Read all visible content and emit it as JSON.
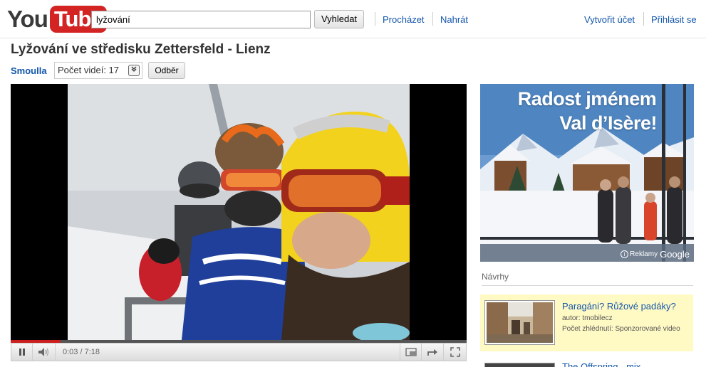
{
  "header": {
    "logo_you": "You",
    "logo_tube": "Tube",
    "search_value": "lyžování",
    "search_button": "Vyhledat",
    "nav_browse": "Procházet",
    "nav_upload": "Nahrát",
    "create_account": "Vytvořit účet",
    "sign_in": "Přihlásit se"
  },
  "video": {
    "title": "Lyžování ve středisku Zettersfeld - Lienz",
    "channel": "Smoulla",
    "video_count": "Počet videí: 17",
    "subscribe": "Odběr",
    "time_current": "0:03",
    "time_total": "7:18",
    "played_fraction": 0.11
  },
  "ad": {
    "line1": "Radost jménem",
    "line2": "Val d’Isère!",
    "footer_label": "Reklamy",
    "footer_brand": "Google"
  },
  "suggestions": {
    "heading": "Návrhy",
    "items": [
      {
        "title": "Paragáni? Růžové padáky?",
        "author": "autor: tmobilecz",
        "views": "Počet zhlédnutí: Sponzorované video"
      },
      {
        "title": "The Offspring - mix"
      }
    ]
  },
  "colors": {
    "brand_red": "#d32323",
    "link_blue": "#1155aa",
    "sponsored_bg": "#fff9c4",
    "progress_red": "#cc1e1e"
  }
}
